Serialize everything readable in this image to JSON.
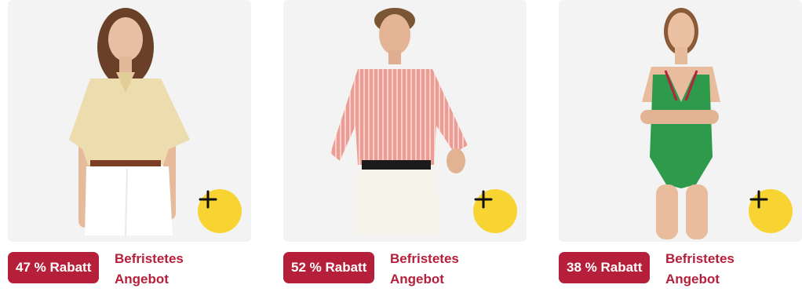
{
  "products": [
    {
      "image": "woman-linen-shirt-white-trousers",
      "discount_badge": "47 % Rabatt",
      "offer_line1": "Befristetes",
      "offer_line2": "Angebot",
      "add_icon": "plus-icon"
    },
    {
      "image": "man-pink-striped-linen-shirt",
      "discount_badge": "52 % Rabatt",
      "offer_line1": "Befristetes",
      "offer_line2": "Angebot",
      "add_icon": "plus-icon"
    },
    {
      "image": "woman-green-swimsuit",
      "discount_badge": "38 % Rabatt",
      "offer_line1": "Befristetes",
      "offer_line2": "Angebot",
      "add_icon": "plus-icon"
    }
  ],
  "colors": {
    "badge_bg": "#b51f3a",
    "offer_text": "#b51f3a",
    "add_button": "#f8d433",
    "image_bg": "#f3f3f3"
  }
}
